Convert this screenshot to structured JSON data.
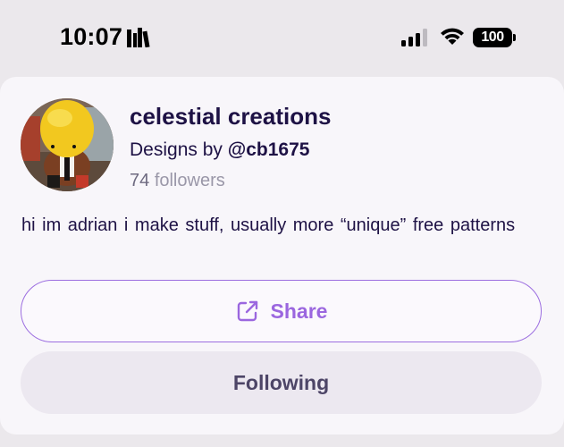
{
  "status_bar": {
    "time": "10:07",
    "battery": "100"
  },
  "profile": {
    "title": "celestial creations",
    "designs_prefix": "Designs by",
    "handle": "@cb1675",
    "followers_count": "74",
    "followers_label": "followers",
    "bio": "hi im adrian i make stuff, usually more “unique” free patterns"
  },
  "actions": {
    "share_label": "Share",
    "following_label": "Following"
  },
  "colors": {
    "accent": "#9b67df",
    "title": "#1e1245",
    "muted": "#9a97a8"
  },
  "icons": [
    "books-icon",
    "signal-icon",
    "wifi-icon",
    "battery-icon",
    "share-icon"
  ]
}
